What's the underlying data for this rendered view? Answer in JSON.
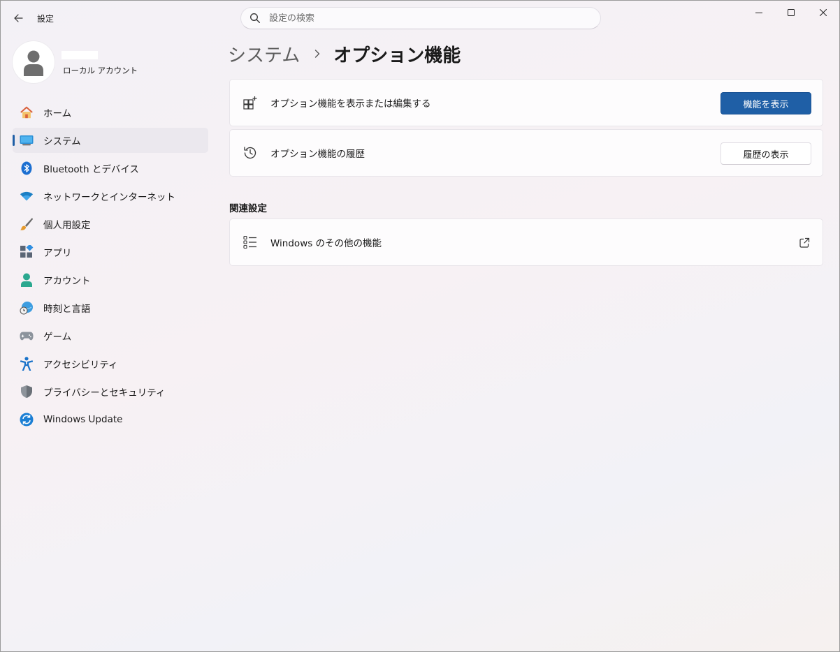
{
  "window": {
    "title": "設定",
    "controls": [
      "minimize-icon",
      "maximize-icon",
      "close-icon"
    ]
  },
  "search": {
    "placeholder": "設定の検索"
  },
  "profile": {
    "account_type": "ローカル アカウント"
  },
  "sidebar": {
    "items": [
      {
        "label": "ホーム",
        "icon": "home-icon"
      },
      {
        "label": "システム",
        "icon": "system-icon",
        "active": true
      },
      {
        "label": "Bluetooth とデバイス",
        "icon": "bluetooth-icon"
      },
      {
        "label": "ネットワークとインターネット",
        "icon": "wifi-icon"
      },
      {
        "label": "個人用設定",
        "icon": "brush-icon"
      },
      {
        "label": "アプリ",
        "icon": "apps-icon"
      },
      {
        "label": "アカウント",
        "icon": "account-icon"
      },
      {
        "label": "時刻と言語",
        "icon": "time-language-icon"
      },
      {
        "label": "ゲーム",
        "icon": "gamepad-icon"
      },
      {
        "label": "アクセシビリティ",
        "icon": "accessibility-icon"
      },
      {
        "label": "プライバシーとセキュリティ",
        "icon": "shield-icon"
      },
      {
        "label": "Windows Update",
        "icon": "update-icon"
      }
    ]
  },
  "breadcrumb": {
    "parent": "システム",
    "current": "オプション機能"
  },
  "cards": {
    "view_features": {
      "label": "オプション機能を表示または編集する",
      "button": "機能を表示"
    },
    "history": {
      "label": "オプション機能の履歴",
      "button": "履歴の表示"
    }
  },
  "related": {
    "header": "関連設定",
    "windows_features": {
      "label": "Windows のその他の機能"
    }
  },
  "colors": {
    "accent": "#1f5fa6"
  }
}
